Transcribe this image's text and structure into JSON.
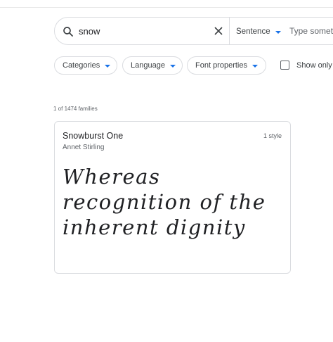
{
  "search": {
    "query": "snow",
    "sentence_label": "Sentence",
    "preview_placeholder": "Type something"
  },
  "filters": {
    "categories_label": "Categories",
    "language_label": "Language",
    "font_properties_label": "Font properties",
    "show_only_label": "Show only"
  },
  "results": {
    "count_text": "1 of 1474 families"
  },
  "card": {
    "family_name": "Snowburst One",
    "designer": "Annet Stirling",
    "style_count": "1 style",
    "sample_text": "Whereas recognition of the inherent dignity"
  },
  "colors": {
    "accent": "#1a73e8",
    "border": "#dadce0",
    "text_secondary": "#5f6368"
  },
  "icons": [
    "search-icon",
    "clear-icon",
    "chevron-down-icon"
  ]
}
